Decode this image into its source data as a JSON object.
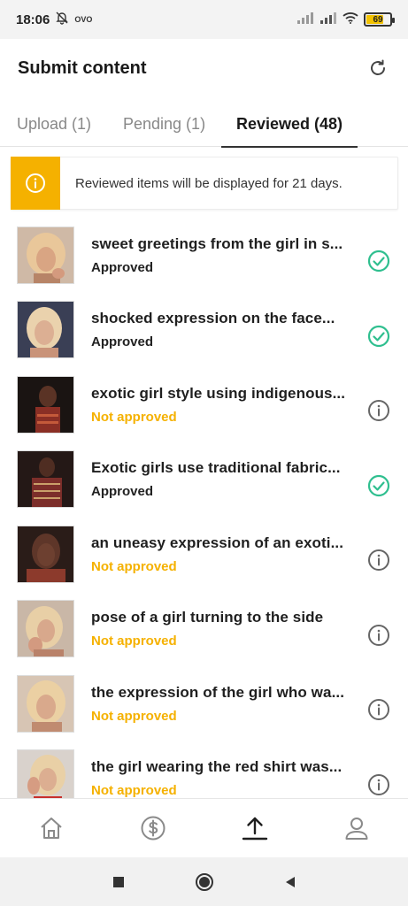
{
  "status_bar": {
    "time": "18:06",
    "operator": "OVO",
    "battery": "69",
    "battery_level": 0.69
  },
  "header": {
    "title": "Submit content",
    "refresh_icon": "refresh-icon"
  },
  "tabs": [
    {
      "label": "Upload (1)",
      "active": false
    },
    {
      "label": "Pending (1)",
      "active": false
    },
    {
      "label": "Reviewed (48)",
      "active": true
    }
  ],
  "banner": {
    "icon": "info-icon",
    "text": "Reviewed items will be displayed for 21 days.",
    "color": "#f5b100"
  },
  "colors": {
    "approved_check": "#2fbf8f",
    "not_approved": "#f5b100",
    "info_gray": "#666666"
  },
  "items": [
    {
      "title": "sweet greetings from the girl in s...",
      "status": "Approved",
      "approved": true
    },
    {
      "title": "shocked expression on the face...",
      "status": "Approved",
      "approved": true
    },
    {
      "title": "exotic girl style using indigenous...",
      "status": "Not approved",
      "approved": false
    },
    {
      "title": "Exotic girls use traditional fabric...",
      "status": "Approved",
      "approved": true
    },
    {
      "title": "an uneasy expression of an exoti...",
      "status": "Not approved",
      "approved": false
    },
    {
      "title": "pose of a girl turning to the side",
      "status": "Not approved",
      "approved": false
    },
    {
      "title": "the expression of the girl who wa...",
      "status": "Not approved",
      "approved": false
    },
    {
      "title": "the girl wearing the red shirt was...",
      "status": "Not approved",
      "approved": false
    }
  ],
  "bottom_nav": [
    {
      "icon": "home-icon",
      "active": false
    },
    {
      "icon": "dollar-icon",
      "active": false
    },
    {
      "icon": "upload-icon",
      "active": true
    },
    {
      "icon": "profile-icon",
      "active": false
    }
  ],
  "system_nav": [
    "recents-icon",
    "home-circle-icon",
    "back-icon"
  ]
}
